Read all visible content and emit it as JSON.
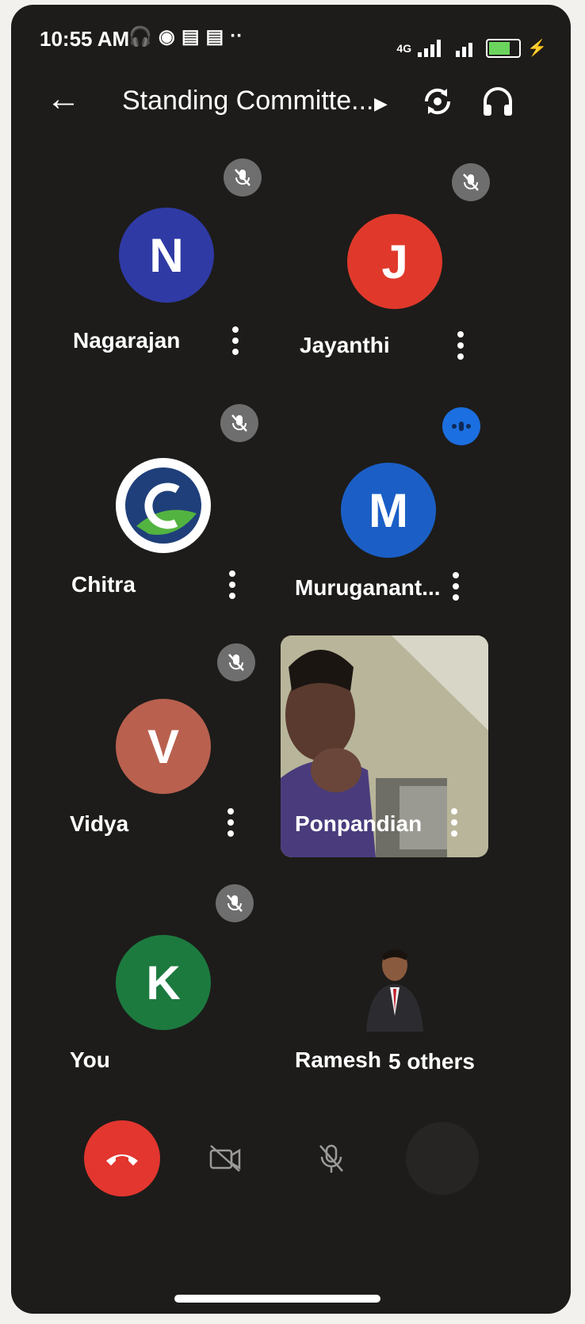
{
  "status_bar": {
    "time": "10:55 AM",
    "network": "4G"
  },
  "app_bar": {
    "title": "Standing Committe..."
  },
  "participants": [
    {
      "name": "Nagarajan",
      "initial": "N",
      "color": "#2f3aa5",
      "muted": true
    },
    {
      "name": "Jayanthi",
      "initial": "J",
      "color": "#e0392b",
      "muted": true
    },
    {
      "name": "Chitra",
      "initial": "C",
      "color": "#ffffff",
      "muted": true,
      "logo": true
    },
    {
      "name": "Muruganant...",
      "initial": "M",
      "color": "#1b5fc6",
      "muted": false,
      "speaking": true
    },
    {
      "name": "Vidya",
      "initial": "V",
      "color": "#b9604f",
      "muted": true
    },
    {
      "name": "Ponpandian",
      "video": true
    },
    {
      "name": "You",
      "initial": "K",
      "color": "#1c7a3f",
      "muted": true
    },
    {
      "name": "Ramesh",
      "photo": true
    }
  ],
  "others_label": "5 others",
  "controls": {
    "end_call": "end-call",
    "camera": "camera-off",
    "mic": "mic-off",
    "more": "more"
  }
}
